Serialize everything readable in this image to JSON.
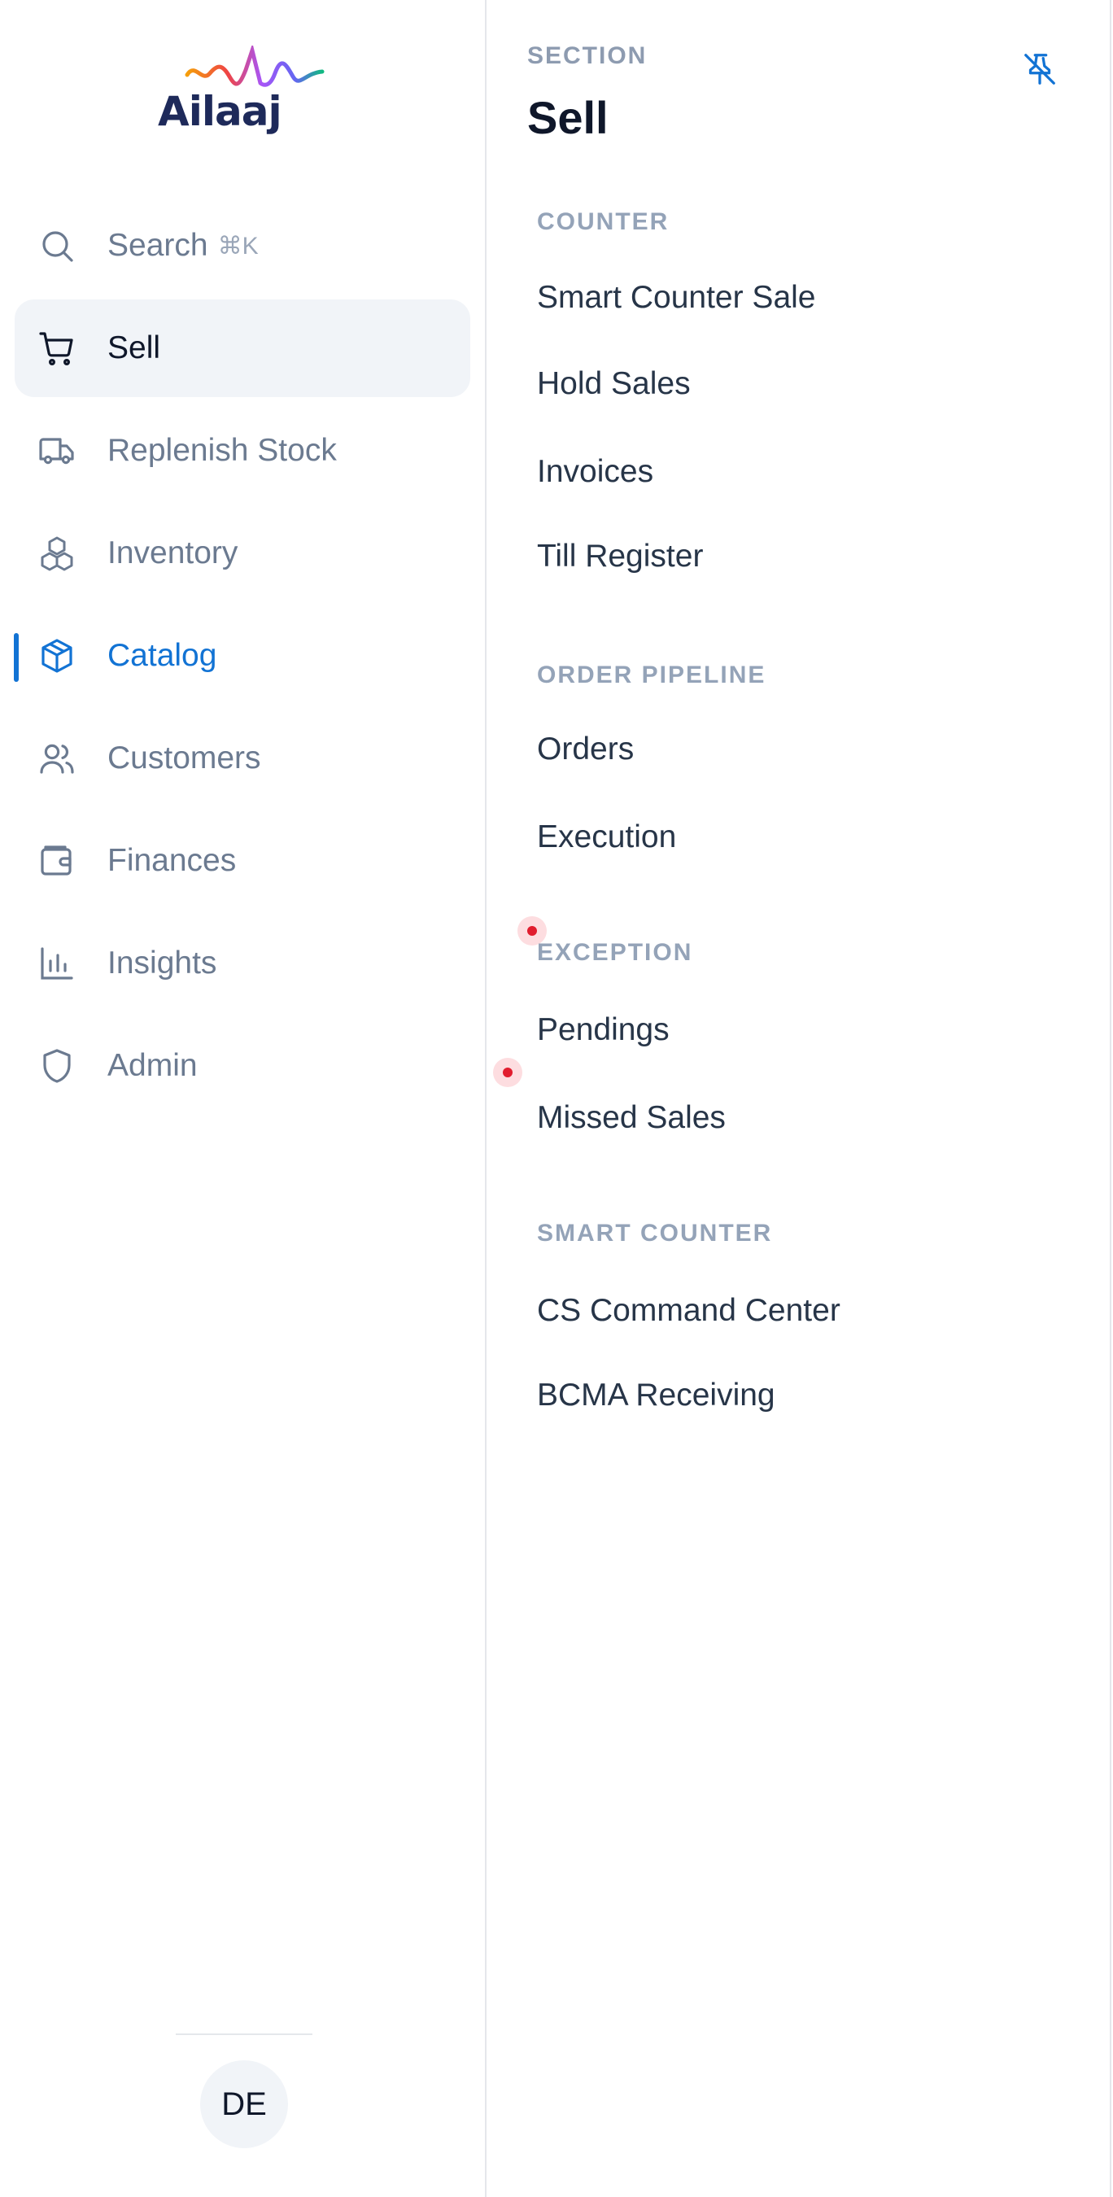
{
  "app": {
    "brand": "Ailaaj"
  },
  "search": {
    "label": "Search",
    "shortcut": "⌘K"
  },
  "nav": [
    {
      "label": "Sell",
      "icon": "cart-icon",
      "state": "active"
    },
    {
      "label": "Replenish Stock",
      "icon": "truck-icon",
      "state": "normal"
    },
    {
      "label": "Inventory",
      "icon": "boxes-icon",
      "state": "normal"
    },
    {
      "label": "Catalog",
      "icon": "package-icon",
      "state": "selected"
    },
    {
      "label": "Customers",
      "icon": "users-icon",
      "state": "normal"
    },
    {
      "label": "Finances",
      "icon": "wallet-icon",
      "state": "normal"
    },
    {
      "label": "Insights",
      "icon": "bar-chart-icon",
      "state": "normal"
    },
    {
      "label": "Admin",
      "icon": "shield-icon",
      "state": "normal"
    }
  ],
  "user": {
    "initials": "DE"
  },
  "panel": {
    "eyebrow": "SECTION",
    "title": "Sell",
    "groups": [
      {
        "heading": "COUNTER",
        "items": [
          "Smart Counter Sale",
          "Hold Sales",
          "Invoices",
          "Till Register"
        ]
      },
      {
        "heading": "ORDER PIPELINE",
        "items": [
          "Orders",
          "Execution"
        ]
      },
      {
        "heading": "EXCEPTION",
        "items": [
          "Pendings",
          "Missed Sales"
        ]
      },
      {
        "heading": "SMART COUNTER",
        "items": [
          "CS Command Center",
          "BCMA Receiving"
        ]
      }
    ]
  },
  "colors": {
    "accent": "#1273d4",
    "active_bg": "#f1f4f8",
    "text_dark": "#0f172a",
    "text_muted": "#6b7a90",
    "heading_muted": "#94a3b8",
    "indicator": "#e11d2e"
  }
}
